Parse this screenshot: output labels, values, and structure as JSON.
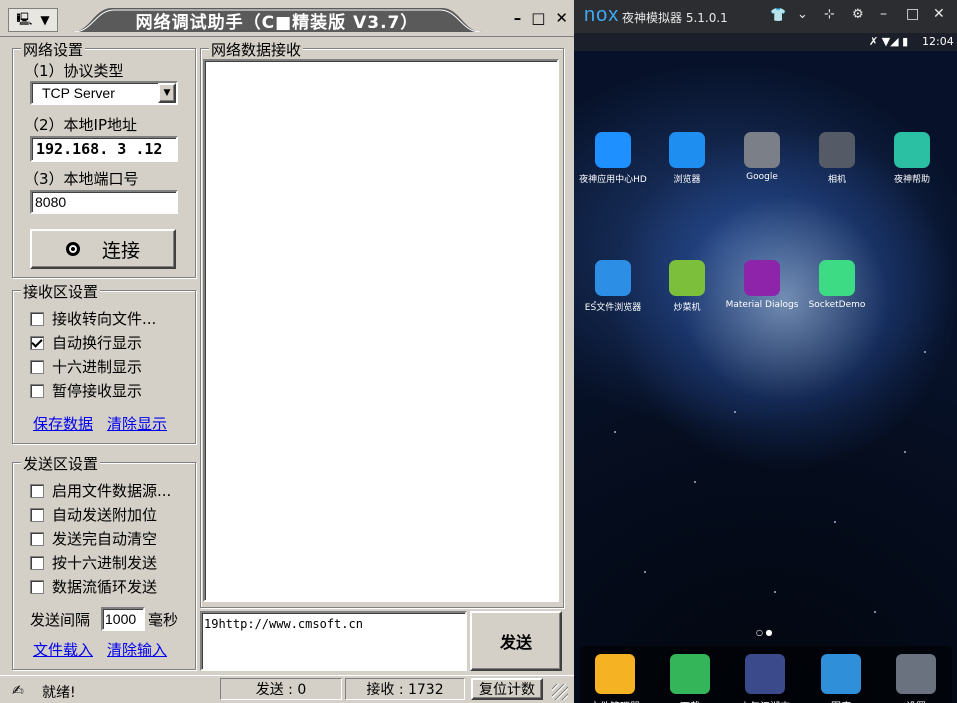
{
  "netassist": {
    "title": "网络调试助手（C■精装版 V3.7）",
    "window_buttons": {
      "minimize": "–",
      "maximize": "□",
      "close": "✕"
    },
    "network_settings": {
      "group_title": "网络设置",
      "protocol_label": "（1）协议类型",
      "protocol_value": "TCP Server",
      "ip_label": "（2）本地IP地址",
      "ip_value": "192.168. 3 .12",
      "port_label": "（3）本地端口号",
      "port_value": "8080",
      "connect_label": "连接"
    },
    "receive_settings": {
      "group_title": "接收区设置",
      "options": [
        {
          "label": "接收转向文件...",
          "checked": false
        },
        {
          "label": "自动换行显示",
          "checked": true
        },
        {
          "label": "十六进制显示",
          "checked": false
        },
        {
          "label": "暂停接收显示",
          "checked": false
        }
      ],
      "save_link": "保存数据",
      "clear_link": "清除显示"
    },
    "send_settings": {
      "group_title": "发送区设置",
      "options": [
        {
          "label": "启用文件数据源...",
          "checked": false
        },
        {
          "label": "自动发送附加位",
          "checked": false
        },
        {
          "label": "发送完自动清空",
          "checked": false
        },
        {
          "label": "按十六进制发送",
          "checked": false
        },
        {
          "label": "数据流循环发送",
          "checked": false
        }
      ],
      "interval_label": "发送间隔",
      "interval_value": "1000",
      "interval_unit": "毫秒",
      "load_file_link": "文件载入",
      "clear_input_link": "清除输入"
    },
    "receive_area": {
      "group_title": "网络数据接收",
      "content": ""
    },
    "send_area": {
      "content": "19http://www.cmsoft.cn",
      "send_button": "发送"
    },
    "statusbar": {
      "ready": "就绪!",
      "sent": "发送 : 0",
      "received": "接收 : 1732",
      "reset": "复位计数"
    }
  },
  "emulator": {
    "brand": "nox",
    "title": "夜神模拟器 5.1.0.1",
    "clock": "12:04",
    "apps": [
      {
        "label": "夜神应用中心HD",
        "icon": "nox-appcenter-icon",
        "color": "#1e90ff"
      },
      {
        "label": "浏览器",
        "icon": "browser-icon",
        "color": "#1f8ef1"
      },
      {
        "label": "Google",
        "icon": "google-folder-icon",
        "color": "#7a7f88"
      },
      {
        "label": "相机",
        "icon": "camera-icon",
        "color": "#555b66"
      },
      {
        "label": "夜神帮助",
        "icon": "help-icon",
        "color": "#2bbfa4"
      },
      {
        "label": "ES文件浏览器",
        "icon": "es-file-icon",
        "color": "#2d8ee6"
      },
      {
        "label": "炒菜机",
        "icon": "android-e4a-icon",
        "color": "#7cbf3a"
      },
      {
        "label": "Material Dialogs",
        "icon": "md-icon",
        "color": "#8e24aa"
      },
      {
        "label": "SocketDemo",
        "icon": "android-icon",
        "color": "#3ddc84"
      }
    ],
    "dock": [
      {
        "label": "文件管理器",
        "icon": "folder-icon",
        "color": "#f5b324"
      },
      {
        "label": "下载",
        "icon": "download-icon",
        "color": "#34b55a"
      },
      {
        "label": "少年江湖志",
        "icon": "game-icon",
        "color": "#3a4a8a"
      },
      {
        "label": "图库",
        "icon": "gallery-icon",
        "color": "#2f8fd8"
      },
      {
        "label": "设置",
        "icon": "settings-icon",
        "color": "#6a7280"
      }
    ]
  }
}
